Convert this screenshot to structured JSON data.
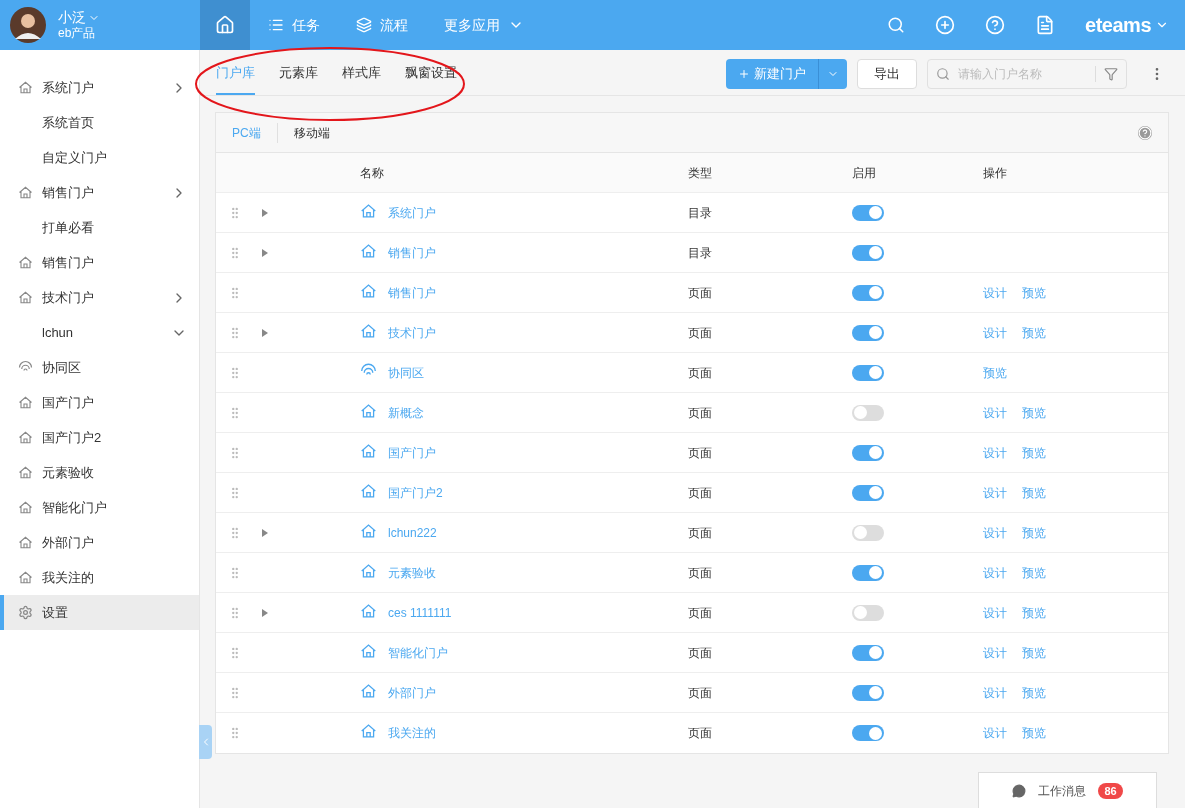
{
  "user": {
    "name": "小泛",
    "org": "eb产品"
  },
  "nav": [
    {
      "kind": "home",
      "selected": true
    },
    {
      "kind": "list",
      "label": "任务",
      "selected": false
    },
    {
      "kind": "layers",
      "label": "流程",
      "selected": false
    },
    {
      "kind": "more",
      "label": "更多应用",
      "selected": false
    }
  ],
  "brand": "eteams",
  "sidebar": {
    "items": [
      {
        "label": "系统门户",
        "kind": "group",
        "expanded": false,
        "selected": false
      },
      {
        "label": "系统首页",
        "kind": "sub",
        "selected": false
      },
      {
        "label": "自定义门户",
        "kind": "sub",
        "selected": false
      },
      {
        "label": "销售门户",
        "kind": "group",
        "expanded": false,
        "selected": false
      },
      {
        "label": "打单必看",
        "kind": "sub",
        "selected": false
      },
      {
        "label": "销售门户",
        "kind": "page",
        "selected": false
      },
      {
        "label": "技术门户",
        "kind": "group",
        "expanded": false,
        "selected": false
      },
      {
        "label": "lchun",
        "kind": "subgroup",
        "expanded": true,
        "selected": false
      },
      {
        "label": "协同区",
        "kind": "signal",
        "selected": false
      },
      {
        "label": "国产门户",
        "kind": "page",
        "selected": false
      },
      {
        "label": "国产门户2",
        "kind": "page",
        "selected": false
      },
      {
        "label": "元素验收",
        "kind": "page",
        "selected": false
      },
      {
        "label": "智能化门户",
        "kind": "page",
        "selected": false
      },
      {
        "label": "外部门户",
        "kind": "page",
        "selected": false
      },
      {
        "label": "我关注的",
        "kind": "page",
        "selected": false
      },
      {
        "label": "设置",
        "kind": "settings",
        "selected": true
      }
    ]
  },
  "tabs": [
    {
      "label": "门户库",
      "selected": true
    },
    {
      "label": "元素库",
      "selected": false
    },
    {
      "label": "样式库",
      "selected": false
    },
    {
      "label": "飘窗设置",
      "selected": false
    }
  ],
  "annotations": [
    {
      "kind": "ellipse",
      "color": "#e3161b"
    }
  ],
  "toolbar": {
    "new_button": "新建门户",
    "export_button": "导出",
    "search": {
      "placeholder": "请输入门户名称"
    }
  },
  "subtabs": [
    {
      "label": "PC端",
      "selected": true
    },
    {
      "label": "移动端",
      "selected": false
    }
  ],
  "table": {
    "columns": [
      "名称",
      "类型",
      "启用",
      "操作"
    ],
    "rows": [
      {
        "name": "系统门户",
        "kind": "house",
        "has_children": true,
        "type": "目录",
        "enabled": true,
        "actions": []
      },
      {
        "name": "销售门户",
        "kind": "house",
        "has_children": true,
        "type": "目录",
        "enabled": true,
        "actions": []
      },
      {
        "name": "销售门户",
        "kind": "house",
        "has_children": false,
        "type": "页面",
        "enabled": true,
        "actions": [
          "设计",
          "预览"
        ]
      },
      {
        "name": "技术门户",
        "kind": "house",
        "has_children": true,
        "type": "页面",
        "enabled": true,
        "actions": [
          "设计",
          "预览"
        ]
      },
      {
        "name": "协同区",
        "kind": "signal",
        "has_children": false,
        "type": "页面",
        "enabled": true,
        "actions": [
          "预览"
        ]
      },
      {
        "name": "新概念",
        "kind": "house",
        "has_children": false,
        "type": "页面",
        "enabled": false,
        "actions": [
          "设计",
          "预览"
        ]
      },
      {
        "name": "国产门户",
        "kind": "house",
        "has_children": false,
        "type": "页面",
        "enabled": true,
        "actions": [
          "设计",
          "预览"
        ]
      },
      {
        "name": "国产门户2",
        "kind": "house",
        "has_children": false,
        "type": "页面",
        "enabled": true,
        "actions": [
          "设计",
          "预览"
        ]
      },
      {
        "name": "lchun222",
        "kind": "house",
        "has_children": true,
        "type": "页面",
        "enabled": false,
        "actions": [
          "设计",
          "预览"
        ]
      },
      {
        "name": "元素验收",
        "kind": "house",
        "has_children": false,
        "type": "页面",
        "enabled": true,
        "actions": [
          "设计",
          "预览"
        ]
      },
      {
        "name": "ces 1111111",
        "kind": "house",
        "has_children": true,
        "type": "页面",
        "enabled": false,
        "actions": [
          "设计",
          "预览"
        ]
      },
      {
        "name": "智能化门户",
        "kind": "house",
        "has_children": false,
        "type": "页面",
        "enabled": true,
        "actions": [
          "设计",
          "预览"
        ]
      },
      {
        "name": "外部门户",
        "kind": "house",
        "has_children": false,
        "type": "页面",
        "enabled": true,
        "actions": [
          "设计",
          "预览"
        ]
      },
      {
        "name": "我关注的",
        "kind": "house",
        "has_children": false,
        "type": "页面",
        "enabled": true,
        "actions": [
          "设计",
          "预览"
        ]
      }
    ]
  },
  "message_button": {
    "label": "工作消息",
    "count": "86"
  }
}
